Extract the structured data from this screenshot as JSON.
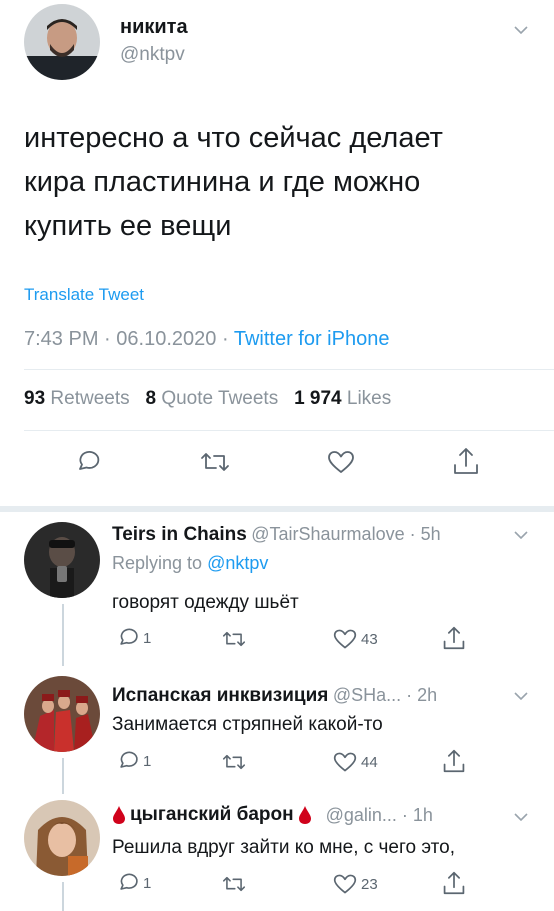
{
  "tweet": {
    "author_name": "никита",
    "author_handle": "@nktpv",
    "text_lines": [
      "интересно а что сейчас делает",
      "кира пластинина и где можно",
      "купить ее вещи"
    ],
    "translate_label": "Translate Tweet",
    "time": "7:43 PM",
    "date": "06.10.2020",
    "sep": "·",
    "source": "Twitter for iPhone"
  },
  "stats": {
    "retweets_count": "93",
    "retweets_label": "Retweets",
    "quotes_count": "8",
    "quotes_label": "Quote Tweets",
    "likes_count": "1 974",
    "likes_label": "Likes"
  },
  "replies": [
    {
      "name": "Teirs in Chains",
      "handle_time": "@TairShaurmalove · 5h",
      "replying_prefix": "Replying to",
      "replying_handle": "@nktpv",
      "text": "говорят одежду шьёт",
      "reply_count": "1",
      "like_count": "43"
    },
    {
      "name": "Испанская инквизиция",
      "handle_time": "@SHa... · 2h",
      "text": "Занимается стряпней какой-то",
      "reply_count": "1",
      "like_count": "44"
    },
    {
      "name": "цыганский барон",
      "handle_time": "@galin... · 1h",
      "text": "Решила вдруг зайти ко мне, с чего это,",
      "reply_count": "1",
      "like_count": "23"
    }
  ],
  "colors": {
    "link": "#1d9bf0",
    "muted": "#8a939b",
    "text": "#14171a",
    "drop": "#d0021b"
  },
  "icons": [
    "chevron-down-icon",
    "reply-icon",
    "retweet-icon",
    "like-icon",
    "share-icon",
    "blood-drop-icon"
  ]
}
